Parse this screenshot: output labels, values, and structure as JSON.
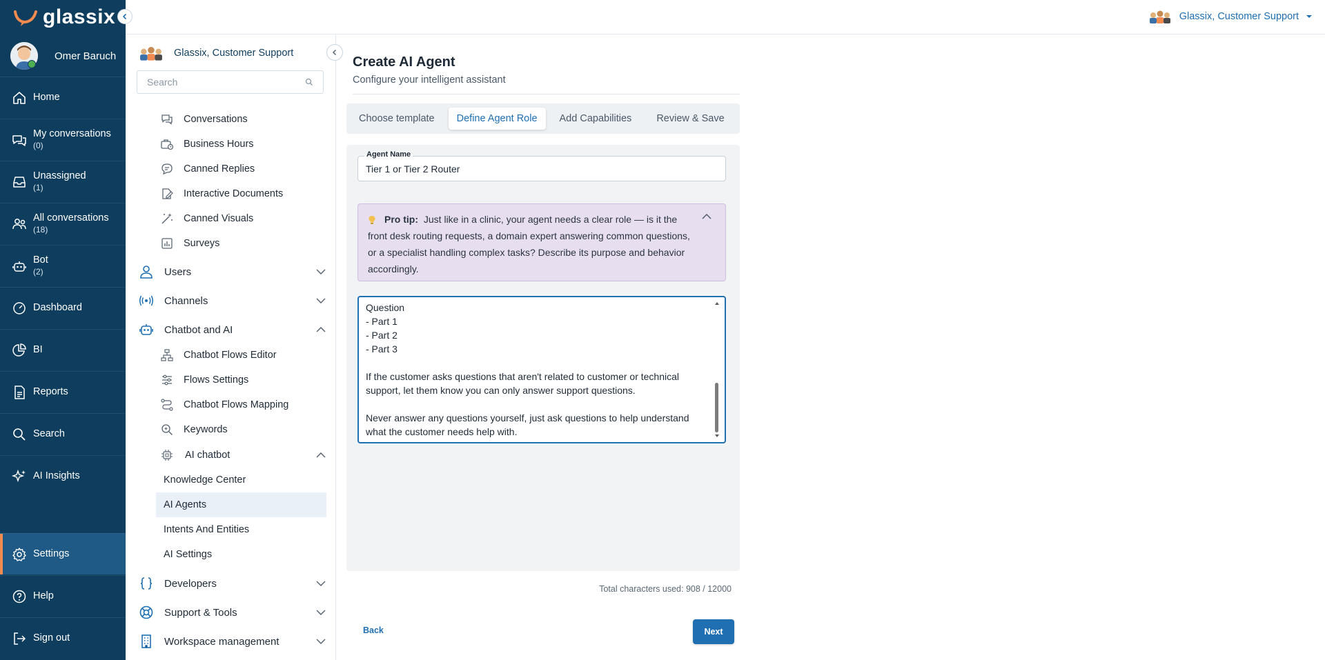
{
  "brand": {
    "name": "glassix"
  },
  "user": {
    "name": "Omer Baruch"
  },
  "nav": [
    {
      "label": "Home",
      "count": "",
      "icon": "home-icon"
    },
    {
      "label": "My conversations",
      "count": "(0)",
      "icon": "conversations-icon"
    },
    {
      "label": "Unassigned",
      "count": "(1)",
      "icon": "inbox-icon"
    },
    {
      "label": "All conversations",
      "count": "(18)",
      "icon": "users-icon"
    },
    {
      "label": "Bot",
      "count": "(2)",
      "icon": "bot-icon"
    },
    {
      "label": "Dashboard",
      "count": "",
      "icon": "dashboard-icon"
    },
    {
      "label": "BI",
      "count": "",
      "icon": "pie-chart-icon"
    },
    {
      "label": "Reports",
      "count": "",
      "icon": "report-icon"
    },
    {
      "label": "Search",
      "count": "",
      "icon": "search-icon"
    },
    {
      "label": "AI Insights",
      "count": "",
      "icon": "sparkle-icon"
    },
    {
      "label": "Settings",
      "count": "",
      "icon": "gear-icon"
    },
    {
      "label": "Help",
      "count": "",
      "icon": "help-icon"
    },
    {
      "label": "Sign out",
      "count": "",
      "icon": "sign-out-icon"
    }
  ],
  "org": {
    "name": "Glassix, Customer Support"
  },
  "settings": {
    "search_placeholder": "Search",
    "items_top": [
      "Conversations",
      "Business Hours",
      "Canned Replies",
      "Interactive Documents",
      "Canned Visuals",
      "Surveys"
    ],
    "groups": {
      "users": "Users",
      "channels": "Channels",
      "chatbot": "Chatbot and AI",
      "developers": "Developers",
      "support": "Support & Tools",
      "workspace": "Workspace management"
    },
    "chatbot_items": [
      "Chatbot Flows Editor",
      "Flows Settings",
      "Chatbot Flows Mapping",
      "Keywords"
    ],
    "ai_chatbot": "AI chatbot",
    "ai_items": [
      "Knowledge Center",
      "AI Agents",
      "Intents And Entities",
      "AI Settings"
    ]
  },
  "page": {
    "title": "Create AI Agent",
    "subtitle": "Configure your intelligent assistant",
    "tabs": [
      "Choose template",
      "Define Agent Role",
      "Add Capabilities",
      "Review & Save"
    ],
    "active_tab": "Define Agent Role"
  },
  "form": {
    "name_label": "Agent Name",
    "name_value": "Tier 1 or Tier 2 Router",
    "protip_label": "Pro tip:",
    "protip_text": "Just like in a clinic, your agent needs a clear role — is it the front desk routing requests, a domain expert answering common questions, or a specialist handling complex tasks? Describe its purpose and behavior accordingly.",
    "role_lines": [
      "Question",
      "- Part 1",
      "- Part 2",
      "- Part 3",
      "",
      "If the customer asks questions that aren't related to customer or technical",
      "support, let them know you can only answer support questions.",
      "",
      "Never answer any questions yourself, just ask questions to help understand",
      "what the customer needs help with."
    ],
    "char_count": "Total characters used: 908 / 12000"
  },
  "actions": {
    "back": "Back",
    "next": "Next"
  },
  "colors": {
    "nav_bg": "#0f3d5e",
    "accent": "#1f6fb2",
    "active_marker": "#f28b50",
    "protip_bg": "#e7def0"
  }
}
